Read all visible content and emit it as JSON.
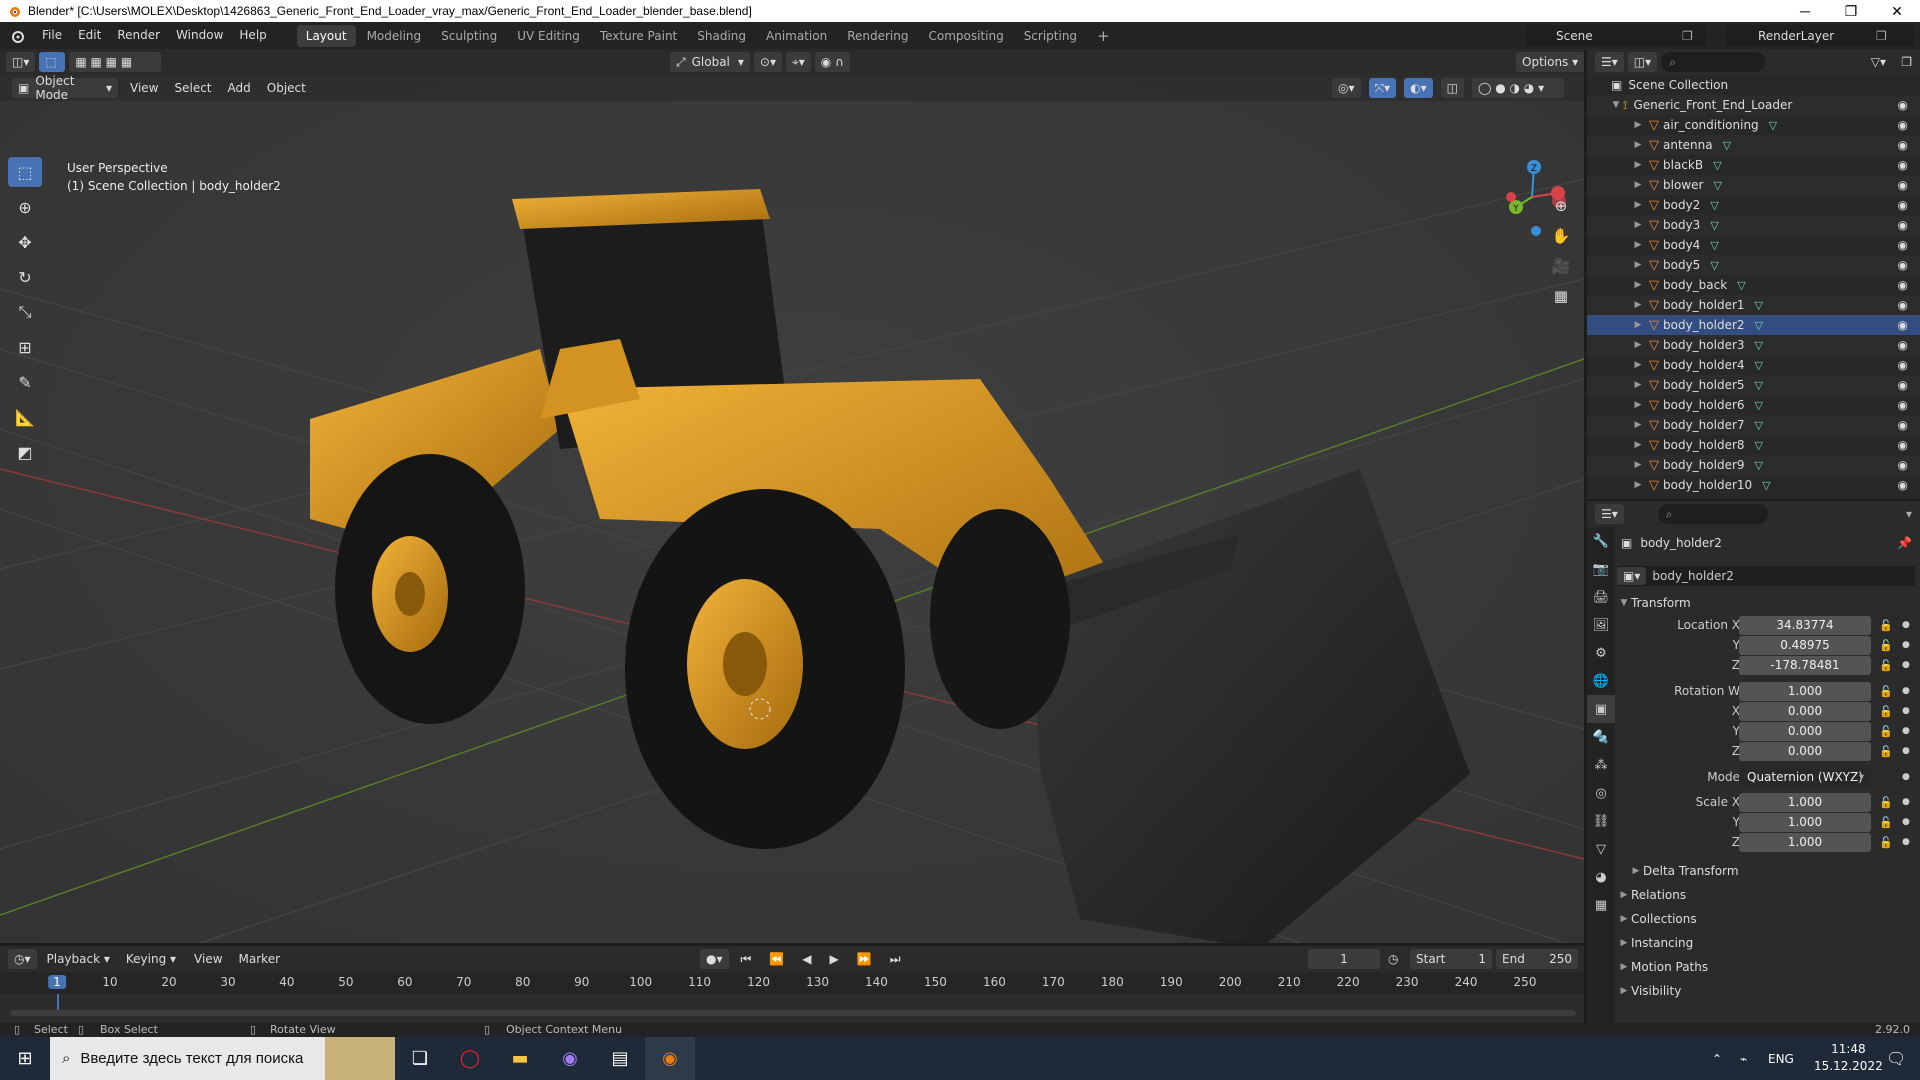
{
  "window": {
    "title": "Blender* [C:\\Users\\MOLEX\\Desktop\\1426863_Generic_Front_End_Loader_vray_max/Generic_Front_End_Loader_blender_base.blend]",
    "minimize": "─",
    "maximize": "❐",
    "close": "✕"
  },
  "menubar": {
    "menus": [
      "File",
      "Edit",
      "Render",
      "Window",
      "Help"
    ],
    "workspaces": [
      "Layout",
      "Modeling",
      "Sculpting",
      "UV Editing",
      "Texture Paint",
      "Shading",
      "Animation",
      "Rendering",
      "Compositing",
      "Scripting"
    ],
    "active_workspace": "Layout",
    "add_workspace": "+",
    "scene": "Scene",
    "render_layer": "RenderLayer"
  },
  "viewport": {
    "transform_orientation": "Global",
    "options": "Options",
    "mode": "Object Mode",
    "menus": [
      "View",
      "Select",
      "Add",
      "Object"
    ],
    "info_line1": "User Perspective",
    "info_line2": "(1) Scene Collection | body_holder2",
    "gizmo": {
      "x": "X",
      "y": "Y",
      "z": "Z"
    }
  },
  "outliner": {
    "root": "Scene Collection",
    "collection": "Generic_Front_End_Loader",
    "items": [
      "air_conditioning",
      "antenna",
      "blackB",
      "blower",
      "body2",
      "body3",
      "body4",
      "body5",
      "body_back",
      "body_holder1",
      "body_holder2",
      "body_holder3",
      "body_holder4",
      "body_holder5",
      "body_holder6",
      "body_holder7",
      "body_holder8",
      "body_holder9",
      "body_holder10"
    ],
    "selected": "body_holder2"
  },
  "properties": {
    "object_name": "body_holder2",
    "data_name": "body_holder2",
    "transform_label": "Transform",
    "location_label": "Location X",
    "y_label": "Y",
    "z_label": "Z",
    "x_label": "X",
    "location": [
      "34.83774",
      "0.48975",
      "-178.78481"
    ],
    "rotation_label": "Rotation W",
    "rotation": [
      "1.000",
      "0.000",
      "0.000",
      "0.000"
    ],
    "mode_label": "Mode",
    "mode_value": "Quaternion (WXYZ)",
    "scale_label": "Scale X",
    "scale": [
      "1.000",
      "1.000",
      "1.000"
    ],
    "sections": [
      "Delta Transform",
      "Relations",
      "Collections",
      "Instancing",
      "Motion Paths",
      "Visibility"
    ]
  },
  "timeline": {
    "menus": [
      "Playback",
      "Keying",
      "View",
      "Marker"
    ],
    "current_frame": "1",
    "start_label": "Start",
    "start": "1",
    "end_label": "End",
    "end": "250",
    "ticks": [
      "1",
      "10",
      "20",
      "30",
      "40",
      "50",
      "60",
      "70",
      "80",
      "90",
      "100",
      "110",
      "120",
      "130",
      "140",
      "150",
      "160",
      "170",
      "180",
      "190",
      "200",
      "210",
      "220",
      "230",
      "240",
      "250"
    ]
  },
  "statusbar": {
    "select": "Select",
    "box_select": "Box Select",
    "rotate_view": "Rotate View",
    "context_menu": "Object Context Menu",
    "version": "2.92.0"
  },
  "taskbar": {
    "search_placeholder": "Введите здесь текст для поиска",
    "language": "ENG",
    "time": "11:48",
    "date": "15.12.2022"
  },
  "colors": {
    "accent": "#4772b3",
    "loader_yellow": "#e0a22a",
    "mesh_icon": "#e2883b",
    "data_icon": "#6fd6a9"
  }
}
